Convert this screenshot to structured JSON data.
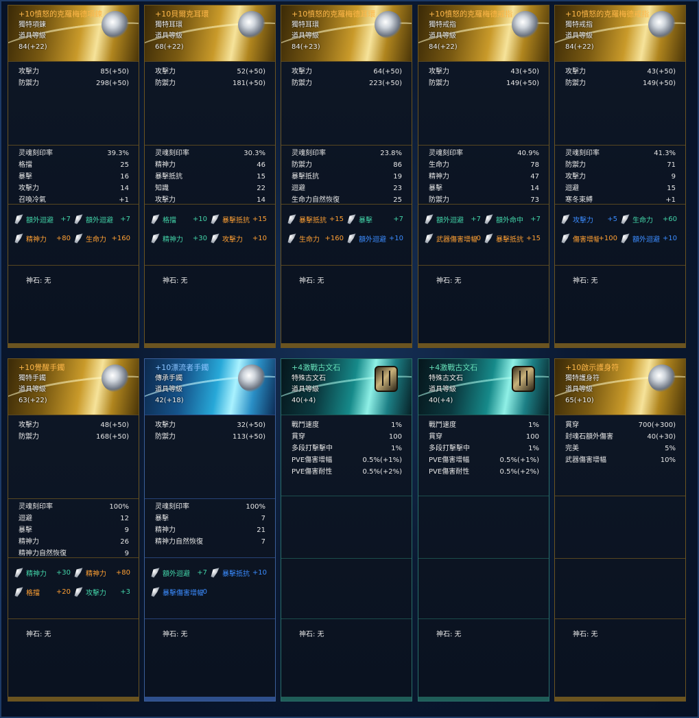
{
  "gem_label": "神石: 无",
  "cards": [
    {
      "name": "+10憤怒的克羅梅德項鍊",
      "name_color": "gold",
      "type": "獨特項鍊",
      "level_label": "道具等級",
      "level": "84(+22)",
      "icon": "necklace-icon",
      "base_stats": [
        [
          "攻擊力",
          "85(+50)"
        ],
        [
          "防禦力",
          "298(+50)"
        ]
      ],
      "soul_stats": [
        [
          "灵魂刻印率",
          "39.3%"
        ],
        [
          "格擋",
          "25"
        ],
        [
          "暴擊",
          "16"
        ],
        [
          "攻擊力",
          "14"
        ],
        [
          "召喚冷氣",
          "+1"
        ]
      ],
      "effects": [
        [
          {
            "label": "額外迴避",
            "value": "+7",
            "color": "teal"
          },
          {
            "label": "額外迴避",
            "value": "+7",
            "color": "teal"
          }
        ],
        [
          {
            "label": "精神力",
            "value": "+80",
            "color": "orange"
          },
          {
            "label": "生命力",
            "value": "+160",
            "color": "orange"
          }
        ]
      ]
    },
    {
      "name": "+10貝爾克耳環",
      "name_color": "gold",
      "type": "獨特耳環",
      "level_label": "道具等級",
      "level": "68(+22)",
      "icon": "earring-icon",
      "base_stats": [
        [
          "攻擊力",
          "52(+50)"
        ],
        [
          "防禦力",
          "181(+50)"
        ]
      ],
      "soul_stats": [
        [
          "灵魂刻印率",
          "30.3%"
        ],
        [
          "精神力",
          "46"
        ],
        [
          "暴擊抵抗",
          "15"
        ],
        [
          "知識",
          "22"
        ],
        [
          "攻擊力",
          "14"
        ]
      ],
      "effects": [
        [
          {
            "label": "格擋",
            "value": "+10",
            "color": "teal"
          },
          {
            "label": "暴擊抵抗",
            "value": "+15",
            "color": "orange"
          }
        ],
        [
          {
            "label": "精神力",
            "value": "+30",
            "color": "teal"
          },
          {
            "label": "攻擊力",
            "value": "+10",
            "color": "orange"
          }
        ]
      ]
    },
    {
      "name": "+10憤怒的克羅梅德耳環",
      "name_color": "gold",
      "type": "獨特耳環",
      "level_label": "道具等級",
      "level": "84(+23)",
      "icon": "earring-icon",
      "base_stats": [
        [
          "攻擊力",
          "64(+50)"
        ],
        [
          "防禦力",
          "223(+50)"
        ]
      ],
      "soul_stats": [
        [
          "灵魂刻印率",
          "23.8%"
        ],
        [
          "防禦力",
          "86"
        ],
        [
          "暴擊抵抗",
          "19"
        ],
        [
          "迴避",
          "23"
        ],
        [
          "生命力自然恢復",
          "25"
        ]
      ],
      "effects": [
        [
          {
            "label": "暴擊抵抗",
            "value": "+15",
            "color": "orange"
          },
          {
            "label": "暴擊",
            "value": "+7",
            "color": "teal"
          }
        ],
        [
          {
            "label": "生命力",
            "value": "+160",
            "color": "orange"
          },
          {
            "label": "額外迴避",
            "value": "+10",
            "color": "blue"
          }
        ]
      ]
    },
    {
      "name": "+10憤怒的克羅梅德戒指",
      "name_color": "gold",
      "type": "獨特戒指",
      "level_label": "道具等級",
      "level": "84(+22)",
      "icon": "ring-icon",
      "base_stats": [
        [
          "攻擊力",
          "43(+50)"
        ],
        [
          "防禦力",
          "149(+50)"
        ]
      ],
      "soul_stats": [
        [
          "灵魂刻印率",
          "40.9%"
        ],
        [
          "生命力",
          "78"
        ],
        [
          "精神力",
          "47"
        ],
        [
          "暴擊",
          "14"
        ],
        [
          "防禦力",
          "73"
        ]
      ],
      "effects": [
        [
          {
            "label": "額外迴避",
            "value": "+7",
            "color": "teal"
          },
          {
            "label": "額外命中",
            "value": "+7",
            "color": "teal"
          }
        ],
        [
          {
            "label": "武器傷害增幅",
            "value": "0",
            "color": "orange"
          },
          {
            "label": "暴擊抵抗",
            "value": "+15",
            "color": "orange"
          }
        ]
      ]
    },
    {
      "name": "+10憤怒的克羅梅德戒指",
      "name_color": "gold",
      "type": "獨特戒指",
      "level_label": "道具等級",
      "level": "84(+22)",
      "icon": "ring-icon",
      "base_stats": [
        [
          "攻擊力",
          "43(+50)"
        ],
        [
          "防禦力",
          "149(+50)"
        ]
      ],
      "soul_stats": [
        [
          "灵魂刻印率",
          "41.3%"
        ],
        [
          "防禦力",
          "71"
        ],
        [
          "攻擊力",
          "9"
        ],
        [
          "迴避",
          "15"
        ],
        [
          "寒冬束縛",
          "+1"
        ]
      ],
      "effects": [
        [
          {
            "label": "攻擊力",
            "value": "+5",
            "color": "blue"
          },
          {
            "label": "生命力",
            "value": "+60",
            "color": "teal"
          }
        ],
        [
          {
            "label": "傷害增幅",
            "value": "+100",
            "color": "orange"
          },
          {
            "label": "額外迴避",
            "value": "+10",
            "color": "blue"
          }
        ]
      ]
    },
    {
      "name": "+10覺醒手鐲",
      "name_color": "gold",
      "type": "獨特手鐲",
      "level_label": "道具等級",
      "level": "63(+22)",
      "icon": "bracelet-icon",
      "base_stats": [
        [
          "攻擊力",
          "48(+50)"
        ],
        [
          "防禦力",
          "168(+50)"
        ]
      ],
      "soul_stats": [
        [
          "灵魂刻印率",
          "100%"
        ],
        [
          "迴避",
          "12"
        ],
        [
          "暴擊",
          "9"
        ],
        [
          "精神力",
          "26"
        ],
        [
          "精神力自然恢復",
          "9"
        ]
      ],
      "effects": [
        [
          {
            "label": "精神力",
            "value": "+30",
            "color": "teal"
          },
          {
            "label": "精神力",
            "value": "+80",
            "color": "orange"
          }
        ],
        [
          {
            "label": "格擋",
            "value": "+20",
            "color": "orange"
          },
          {
            "label": "攻擊力",
            "value": "+3",
            "color": "teal"
          }
        ]
      ]
    },
    {
      "name": "+10漂流者手鐲",
      "name_color": "bluename",
      "type": "傳承手鐲",
      "level_label": "道具等級",
      "level": "42(+18)",
      "icon": "bracelet-icon",
      "base_stats": [
        [
          "攻擊力",
          "32(+50)"
        ],
        [
          "防禦力",
          "113(+50)"
        ]
      ],
      "soul_stats": [
        [
          "灵魂刻印率",
          "100%"
        ],
        [
          "暴擊",
          "7"
        ],
        [
          "精神力",
          "21"
        ],
        [
          "精神力自然恢復",
          "7"
        ]
      ],
      "effects": [
        [
          {
            "label": "額外迴避",
            "value": "+7",
            "color": "teal"
          },
          {
            "label": "暴擊抵抗",
            "value": "+10",
            "color": "blue"
          }
        ],
        [
          {
            "label": "暴擊傷害增幅",
            "value": "0",
            "color": "blue"
          }
        ]
      ]
    },
    {
      "name": "+4激戰古文石",
      "name_color": "teal",
      "type": "特殊古文石",
      "level_label": "道具等級",
      "level": "40(+4)",
      "icon": "rune-stone-icon",
      "base_stats": [
        [
          "戰鬥速度",
          "1%"
        ],
        [
          "貫穿",
          "100"
        ],
        [
          "多段打擊擊中",
          "1%"
        ],
        [
          "PVE傷害增幅",
          "0.5%(+1%)"
        ],
        [
          "PVE傷害耐性",
          "0.5%(+2%)"
        ]
      ],
      "soul_stats": [],
      "effects": []
    },
    {
      "name": "+4激戰古文石",
      "name_color": "teal",
      "type": "特殊古文石",
      "level_label": "道具等級",
      "level": "40(+4)",
      "icon": "rune-stone-icon",
      "base_stats": [
        [
          "戰鬥速度",
          "1%"
        ],
        [
          "貫穿",
          "100"
        ],
        [
          "多段打擊擊中",
          "1%"
        ],
        [
          "PVE傷害增幅",
          "0.5%(+1%)"
        ],
        [
          "PVE傷害耐性",
          "0.5%(+2%)"
        ]
      ],
      "soul_stats": [],
      "effects": []
    },
    {
      "name": "+10啟示護身符",
      "name_color": "gold",
      "type": "獨特護身符",
      "level_label": "道具等級",
      "level": "65(+10)",
      "icon": "amulet-icon",
      "base_stats": [
        [
          "貫穿",
          "700(+300)"
        ],
        [
          "封魂石額外傷害",
          "40(+30)"
        ],
        [
          "完美",
          "5%"
        ],
        [
          "武器傷害增幅",
          "10%"
        ]
      ],
      "soul_stats": [],
      "effects": []
    }
  ]
}
